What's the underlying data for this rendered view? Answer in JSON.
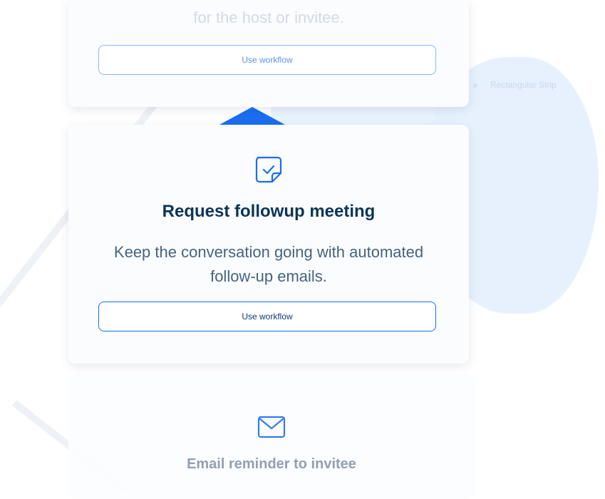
{
  "background": {
    "ghost_label": "Rectangular Strip"
  },
  "top_card": {
    "faded_title": "for the host or invitee.",
    "button_label": "Use workflow"
  },
  "main_card": {
    "icon": "checkbox-note-icon",
    "title": "Request followup meeting",
    "description": "Keep the conversation going with automated follow-up emails.",
    "button_label": "Use workflow"
  },
  "bottom_card": {
    "icon": "envelope-icon",
    "title": "Email reminder to invitee"
  },
  "colors": {
    "accent": "#1a6ef0",
    "title": "#0b3558",
    "text": "#476282"
  }
}
